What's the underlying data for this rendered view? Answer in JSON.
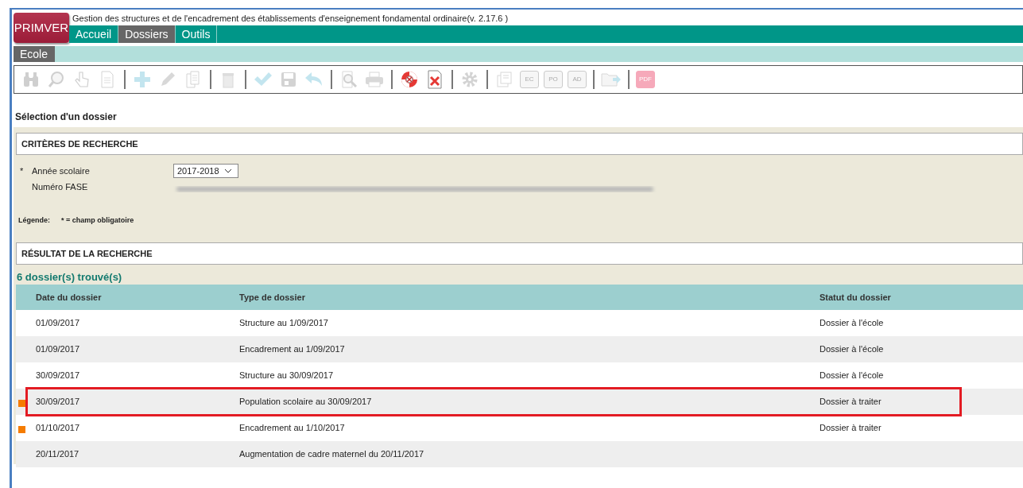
{
  "app": {
    "logo": "PRIMVER",
    "title": "Gestion des structures et de l'encadrement des établissements d'enseignement fondamental ordinaire(v. 2.17.6 )"
  },
  "menu": [
    {
      "label": "Accueil",
      "selected": false
    },
    {
      "label": "Dossiers",
      "selected": true
    },
    {
      "label": "Outils",
      "selected": false
    }
  ],
  "submenu": [
    {
      "label": "Ecole",
      "selected": true
    }
  ],
  "toolbar": [
    [
      {
        "kind": "binoculars",
        "disabled": true
      },
      {
        "kind": "search",
        "disabled": true
      },
      {
        "kind": "hand",
        "disabled": true
      },
      {
        "kind": "document",
        "disabled": true
      }
    ],
    [
      {
        "kind": "add",
        "disabled": true
      },
      {
        "kind": "edit",
        "disabled": true
      },
      {
        "kind": "copy",
        "disabled": true
      }
    ],
    [
      {
        "kind": "delete",
        "disabled": true
      }
    ],
    [
      {
        "kind": "check",
        "disabled": true
      },
      {
        "kind": "save",
        "disabled": true
      },
      {
        "kind": "undo",
        "disabled": true
      }
    ],
    [
      {
        "kind": "preview",
        "disabled": true
      },
      {
        "kind": "print",
        "disabled": true
      }
    ],
    [
      {
        "kind": "lifebuoy",
        "disabled": false
      },
      {
        "kind": "remove",
        "disabled": false
      }
    ],
    [
      {
        "kind": "settings",
        "disabled": true
      }
    ],
    [
      {
        "kind": "stack",
        "disabled": true
      },
      {
        "kind": "tag",
        "label": "EC",
        "disabled": true
      },
      {
        "kind": "tag",
        "label": "PO",
        "disabled": true
      },
      {
        "kind": "tag",
        "label": "AD",
        "disabled": true
      }
    ],
    [
      {
        "kind": "export",
        "disabled": true
      }
    ],
    [
      {
        "kind": "pdf",
        "label": "PDF",
        "disabled": true
      }
    ]
  ],
  "page_title": "Sélection d'un dossier",
  "criteria": {
    "heading": "CRITÈRES DE RECHERCHE",
    "fields": [
      {
        "required_mark": "*",
        "label": "Année scolaire",
        "kind": "select",
        "value": "2017-2018"
      },
      {
        "label": "Numéro FASE",
        "kind": "redacted"
      }
    ],
    "legend": {
      "label": "Légende:",
      "text": "* = champ obligatoire"
    }
  },
  "results": {
    "heading": "RÉSULTAT DE LA RECHERCHE",
    "count": "6 dossier(s) trouvé(s)",
    "columns": [
      "Date du dossier",
      "Type de dossier",
      "Statut du dossier"
    ],
    "rows": [
      {
        "date": "01/09/2017",
        "type": "Structure au 1/09/2017",
        "status": "Dossier à l'école",
        "flagged": false,
        "highlighted": false
      },
      {
        "date": "01/09/2017",
        "type": "Encadrement au 1/09/2017",
        "status": "Dossier à l'école",
        "flagged": false,
        "highlighted": false
      },
      {
        "date": "30/09/2017",
        "type": "Structure au 30/09/2017",
        "status": "Dossier à l'école",
        "flagged": false,
        "highlighted": false
      },
      {
        "date": "30/09/2017",
        "type": "Population scolaire au 30/09/2017",
        "status": "Dossier à traiter",
        "flagged": true,
        "highlighted": true
      },
      {
        "date": "01/10/2017",
        "type": "Encadrement au 1/10/2017",
        "status": "Dossier à traiter",
        "flagged": true,
        "highlighted": false
      },
      {
        "date": "20/11/2017",
        "type": "Augmentation de cadre maternel du 20/11/2017",
        "flagged": false,
        "highlighted": false
      }
    ]
  }
}
